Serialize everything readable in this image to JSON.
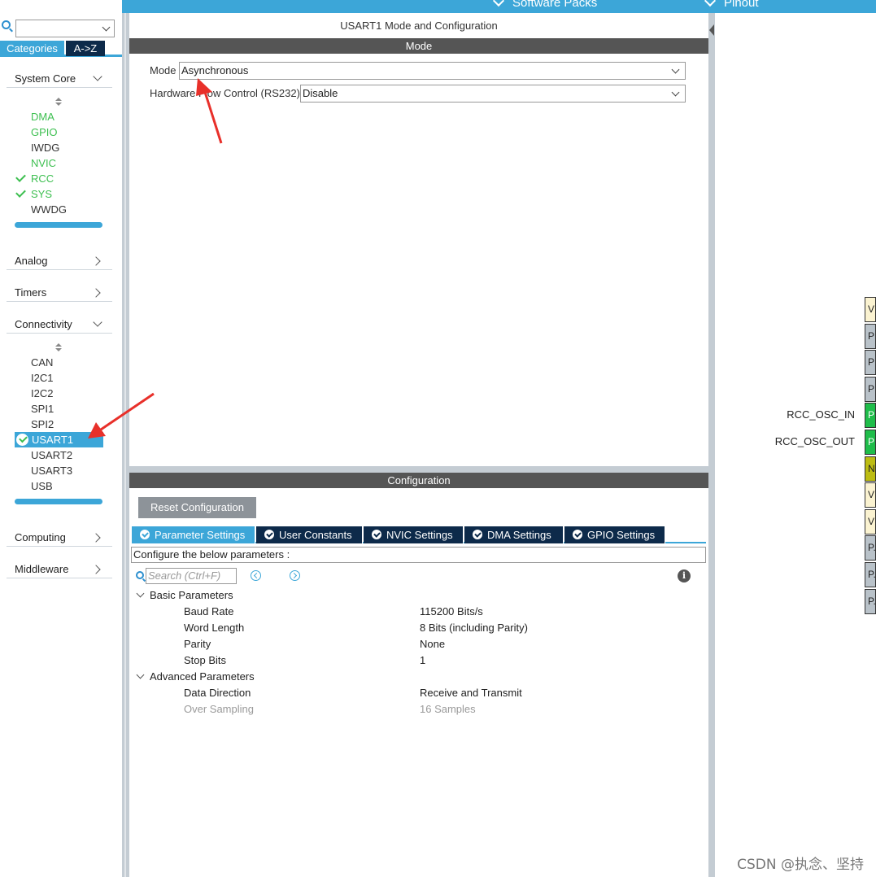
{
  "topbar": {
    "software_packs": "Software Packs",
    "pinout": "Pinout"
  },
  "left": {
    "tabs": {
      "categories": "Categories",
      "az": "A->Z"
    },
    "system_core": {
      "label": "System Core",
      "items": [
        {
          "label": "DMA",
          "state": "green"
        },
        {
          "label": "GPIO",
          "state": "green"
        },
        {
          "label": "IWDG",
          "state": "normal"
        },
        {
          "label": "NVIC",
          "state": "green"
        },
        {
          "label": "RCC",
          "state": "checked"
        },
        {
          "label": "SYS",
          "state": "checked"
        },
        {
          "label": "WWDG",
          "state": "normal"
        }
      ]
    },
    "analog": "Analog",
    "timers": "Timers",
    "connectivity": {
      "label": "Connectivity",
      "items": [
        "CAN",
        "I2C1",
        "I2C2",
        "SPI1",
        "SPI2",
        "USART1",
        "USART2",
        "USART3",
        "USB"
      ],
      "selected": "USART1"
    },
    "computing": "Computing",
    "middleware": "Middleware"
  },
  "mode_panel": {
    "title": "USART1 Mode and Configuration",
    "section": "Mode",
    "mode_label": "Mode",
    "mode_value": "Asynchronous",
    "flow_label": "Hardware Flow Control (RS232)",
    "flow_value": "Disable"
  },
  "config_panel": {
    "section": "Configuration",
    "reset_button": "Reset Configuration",
    "tabs": [
      "Parameter Settings",
      "User Constants",
      "NVIC Settings",
      "DMA Settings",
      "GPIO Settings"
    ],
    "active_tab": "Parameter Settings",
    "hint": "Configure the below parameters :",
    "search_placeholder": "Search (Ctrl+F)",
    "groups": [
      {
        "name": "Basic Parameters",
        "params": [
          {
            "name": "Baud Rate",
            "value": "115200 Bits/s"
          },
          {
            "name": "Word Length",
            "value": "8 Bits (including Parity)"
          },
          {
            "name": "Parity",
            "value": "None"
          },
          {
            "name": "Stop Bits",
            "value": "1"
          }
        ]
      },
      {
        "name": "Advanced Parameters",
        "params": [
          {
            "name": "Data Direction",
            "value": "Receive and Transmit"
          },
          {
            "name": "Over Sampling",
            "value": "16 Samples",
            "disabled": true
          }
        ]
      }
    ]
  },
  "pinout": {
    "pins": [
      {
        "text": "V",
        "color": "beige"
      },
      {
        "text": "P",
        "color": "gray"
      },
      {
        "text": "P",
        "color": "gray"
      },
      {
        "text": "P",
        "color": "gray"
      },
      {
        "text": "P",
        "color": "green",
        "label": "RCC_OSC_IN"
      },
      {
        "text": "P",
        "color": "green",
        "label": "RCC_OSC_OUT"
      },
      {
        "text": "N",
        "color": "olive"
      },
      {
        "text": "V",
        "color": "beige"
      },
      {
        "text": "V",
        "color": "beige"
      },
      {
        "text": "P.",
        "color": "gray"
      },
      {
        "text": "P.",
        "color": "gray"
      },
      {
        "text": "P.",
        "color": "gray"
      }
    ]
  },
  "colors": {
    "accent_blue": "#3ca6d8",
    "dark_navy": "#0d2a4a",
    "enabled_green": "#3dbf50",
    "annotation_red": "#e8302a"
  },
  "watermark": "CSDN @执念、坚持"
}
